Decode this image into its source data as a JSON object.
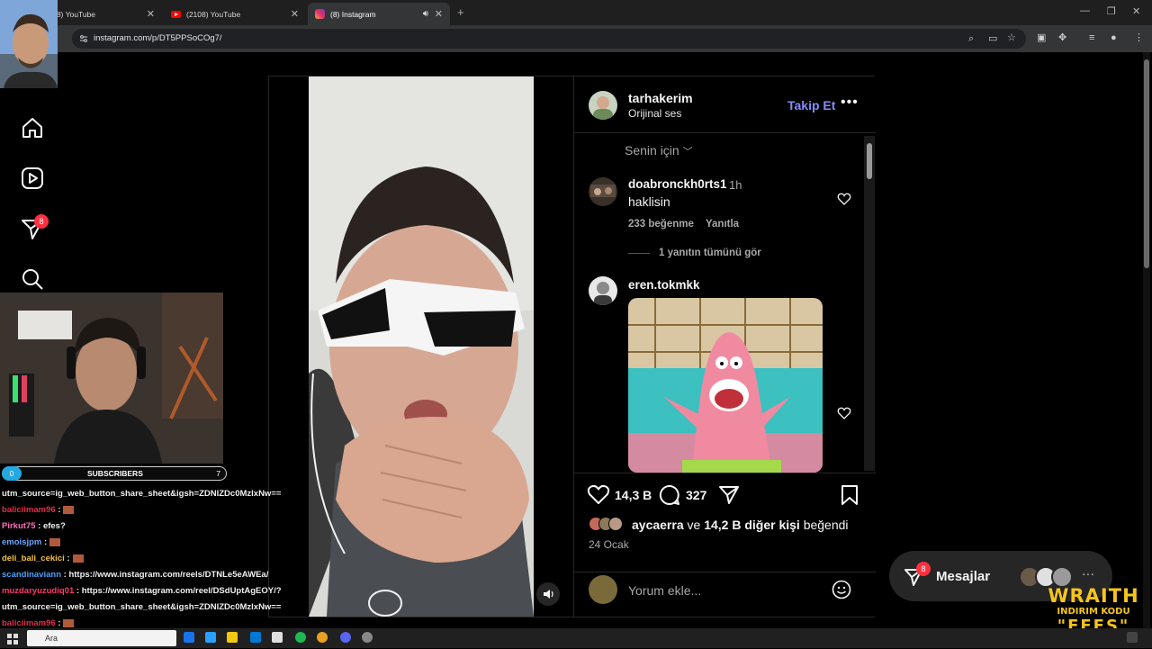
{
  "browser": {
    "tabs": [
      {
        "title": "(8) YouTube"
      },
      {
        "title": "(2108) YouTube"
      },
      {
        "title": "(8) Instagram"
      }
    ],
    "url": "instagram.com/p/DT5PPSoCOg7/"
  },
  "sidenav": {
    "notification_count": "8"
  },
  "post": {
    "author": "tarhakerim",
    "audio": "Orijinal ses",
    "follow_label": "Takip Et",
    "sort_label": "Senin için",
    "comments": [
      {
        "user": "doabronckh0rts1",
        "time": "1h",
        "text": "haklisin",
        "likes": "233 beğenme",
        "reply_label": "Yanıtla",
        "view_replies": "1 yanıtın tümünü gör"
      },
      {
        "user": "eren.tokmkk",
        "gif": true
      }
    ],
    "like_count": "14,3 B",
    "comment_count": "327",
    "liked_by_user": "aycaerra",
    "liked_by_rest": "ve",
    "liked_by_others": "14,2 B diğer kişi",
    "liked_by_suffix": "beğendi",
    "date": "24 Ocak",
    "comment_placeholder": "Yorum ekle..."
  },
  "messages": {
    "label": "Mesajlar",
    "badge": "8",
    "more": "···"
  },
  "overlay": {
    "subscribers_label": "SUBSCRIBERS",
    "subscribers_start": "0",
    "subscribers_goal": "7",
    "chat": [
      {
        "user": "",
        "text": "utm_source=ig_web_button_share_sheet&igsh=ZDNlZDc0MzlxNw==",
        "color": "#ffffff"
      },
      {
        "user": "baliciimam96",
        "text": ":",
        "color": "#e0304a",
        "emote": true
      },
      {
        "user": "Pirkut75",
        "text": ": efes?",
        "color": "#ff70b8"
      },
      {
        "user": "emoisjpm",
        "text": ":",
        "color": "#6aa8ff",
        "emote": true
      },
      {
        "user": "deli_bali_cekici",
        "text": ":",
        "color": "#f0c040",
        "emote": true
      },
      {
        "user": "scandinaviann",
        "text": ": https://www.instagram.com/reels/DTNLe5eAWEa/",
        "color": "#4aa0ff"
      },
      {
        "user": "muzdaryuzudiq01",
        "text": ": https://www.instagram.com/reel/DSdUptAgEOY/?",
        "color": "#ff3a6a"
      },
      {
        "user": "",
        "text": "utm_source=ig_web_button_share_sheet&igsh=ZDNlZDc0MzlxNw==",
        "color": "#ffffff"
      },
      {
        "user": "baliciimam96",
        "text": ":",
        "color": "#e0304a",
        "emote": true
      }
    ],
    "brand_line1": "WRAITH",
    "brand_line2": "INDIRIM KODU",
    "brand_line3": "\"EFES\""
  },
  "taskbar": {
    "search_placeholder": "Ara"
  }
}
